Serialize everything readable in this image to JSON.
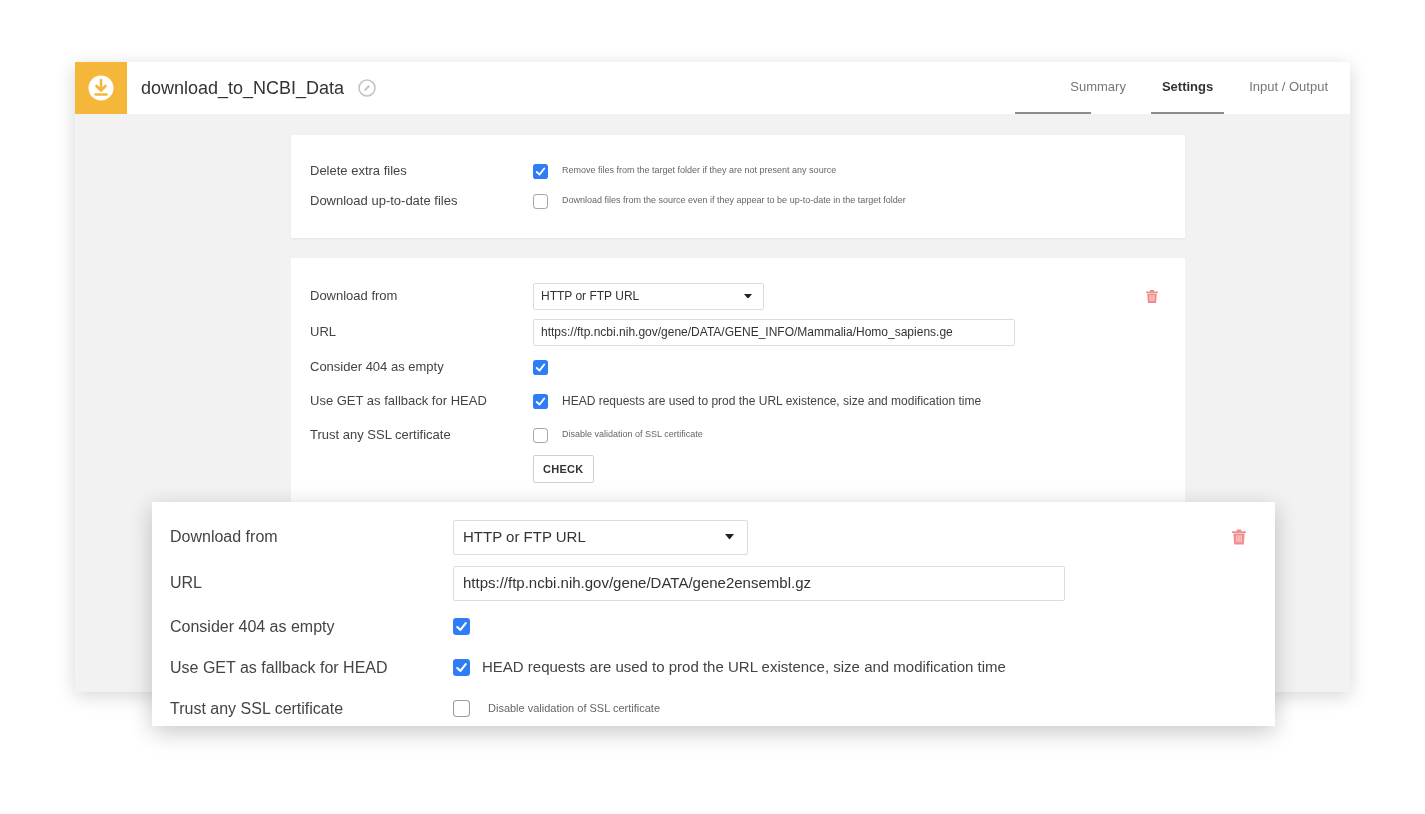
{
  "header": {
    "title": "download_to_NCBI_Data"
  },
  "tabs": [
    {
      "label": "Summary",
      "selected": false
    },
    {
      "label": "Settings",
      "selected": true
    },
    {
      "label": "Input / Output",
      "selected": false
    }
  ],
  "options": [
    {
      "label": "Delete extra files",
      "checked": true,
      "hint": "Remove files from the target folder if they are not present any source"
    },
    {
      "label": "Download up-to-date files",
      "checked": false,
      "hint": "Download files from the source even if they appear to be up-to-date in the target folder"
    }
  ],
  "source": {
    "rows": [
      {
        "kind": "select",
        "label": "Download from",
        "value": "HTTP or FTP URL"
      },
      {
        "kind": "text",
        "label": "URL",
        "value": "https://ftp.ncbi.nih.gov/gene/DATA/GENE_INFO/Mammalia/Homo_sapiens.ge"
      },
      {
        "kind": "checkbox",
        "label": "Consider 404 as empty",
        "checked": true
      },
      {
        "kind": "checkbox",
        "label": "Use GET as fallback for HEAD",
        "checked": true,
        "description": "HEAD requests are used to prod the URL existence, size and modification time"
      },
      {
        "kind": "checkbox",
        "label": "Trust any SSL certificate",
        "checked": false,
        "hint": "Disable validation of SSL certificate"
      }
    ],
    "button": "CHECK"
  },
  "zoomed_source": {
    "rows": [
      {
        "kind": "select",
        "label": "Download from",
        "value": "HTTP or FTP URL"
      },
      {
        "kind": "text",
        "label": "URL",
        "value": "https://ftp.ncbi.nih.gov/gene/DATA/gene2ensembl.gz"
      },
      {
        "kind": "checkbox",
        "label": "Consider 404 as empty",
        "checked": true
      },
      {
        "kind": "checkbox",
        "label": "Use GET as fallback for HEAD",
        "checked": true,
        "description": "HEAD requests are used to prod the URL existence, size and modification time"
      },
      {
        "kind": "checkbox",
        "label": "Trust any SSL certificate",
        "checked": false,
        "hint": "Disable validation of SSL certificate"
      }
    ]
  }
}
